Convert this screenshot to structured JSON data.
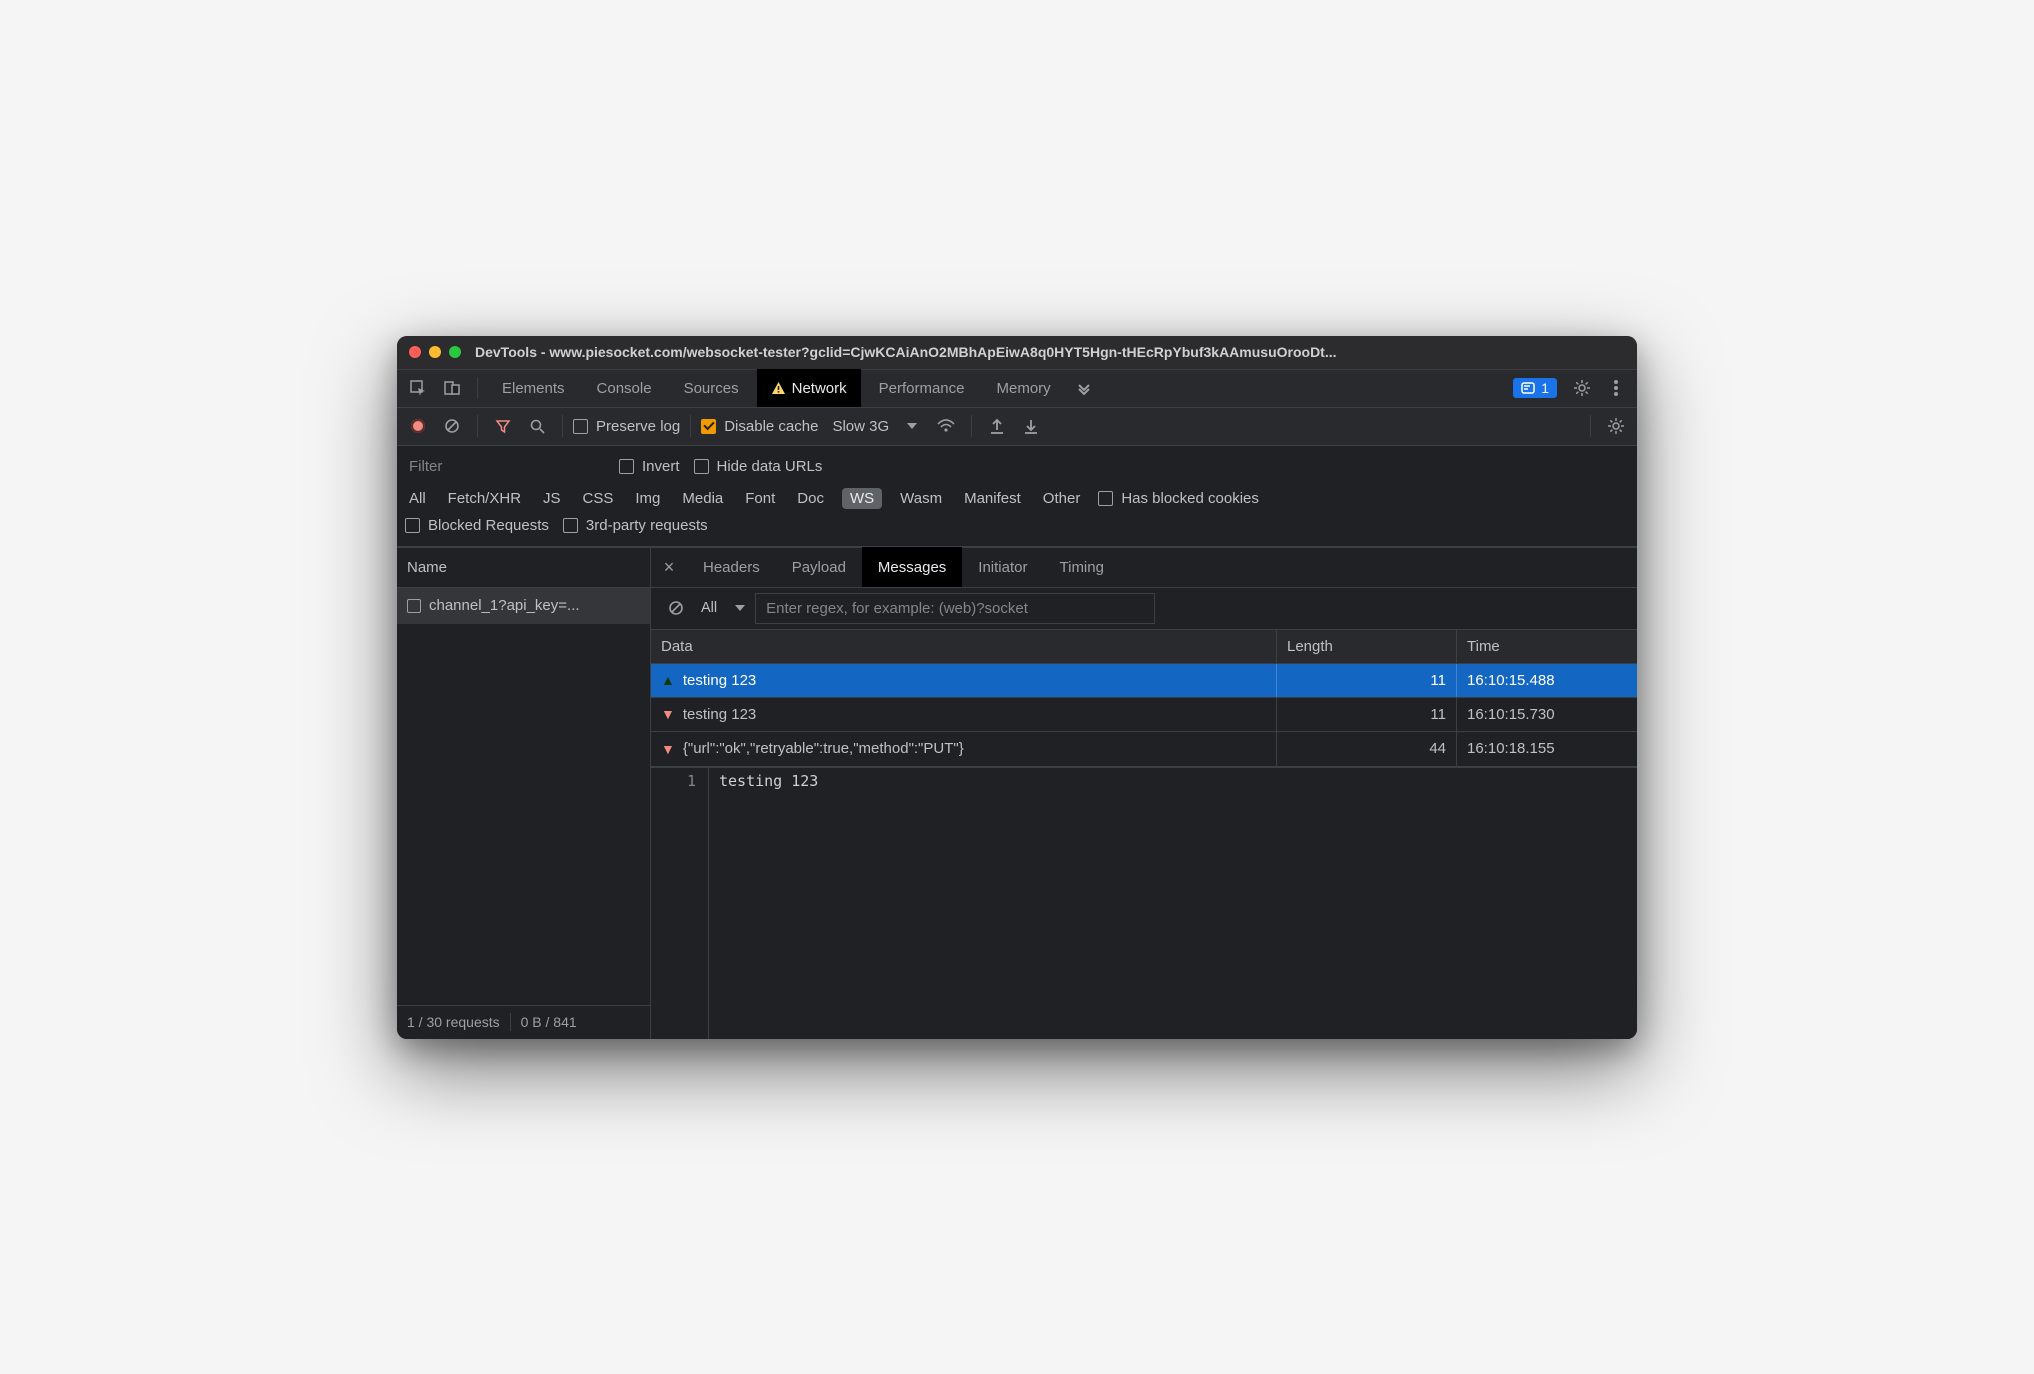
{
  "window": {
    "title": "DevTools - www.piesocket.com/websocket-tester?gclid=CjwKCAiAnO2MBhApEiwA8q0HYT5Hgn-tHEcRpYbuf3kAAmusuOrooDt..."
  },
  "main_tabs": [
    "Elements",
    "Console",
    "Sources",
    "Network",
    "Performance",
    "Memory"
  ],
  "main_tab_active": "Network",
  "issues_badge": "1",
  "toolbar": {
    "preserve_log_label": "Preserve log",
    "disable_cache_label": "Disable cache",
    "disable_cache_checked": true,
    "throttling": "Slow 3G"
  },
  "filter": {
    "placeholder": "Filter",
    "invert_label": "Invert",
    "hide_data_urls_label": "Hide data URLs",
    "types": [
      "All",
      "Fetch/XHR",
      "JS",
      "CSS",
      "Img",
      "Media",
      "Font",
      "Doc",
      "WS",
      "Wasm",
      "Manifest",
      "Other"
    ],
    "type_selected": "WS",
    "has_blocked_cookies_label": "Has blocked cookies",
    "blocked_requests_label": "Blocked Requests",
    "third_party_label": "3rd-party requests"
  },
  "sidebar": {
    "header": "Name",
    "requests": [
      {
        "label": "channel_1?api_key=..."
      }
    ],
    "status_requests": "1 / 30 requests",
    "status_bytes": "0 B / 841"
  },
  "detail_tabs": [
    "Headers",
    "Payload",
    "Messages",
    "Initiator",
    "Timing"
  ],
  "detail_tab_active": "Messages",
  "messages": {
    "filter_mode": "All",
    "regex_placeholder": "Enter regex, for example: (web)?socket",
    "columns": {
      "data": "Data",
      "length": "Length",
      "time": "Time"
    },
    "rows": [
      {
        "dir": "up",
        "data": "testing 123",
        "length": "11",
        "time": "16:10:15.488",
        "selected": true
      },
      {
        "dir": "down",
        "data": "testing 123",
        "length": "11",
        "time": "16:10:15.730"
      },
      {
        "dir": "down",
        "data": "{\"url\":\"ok\",\"retryable\":true,\"method\":\"PUT\"}",
        "length": "44",
        "time": "16:10:18.155"
      }
    ],
    "preview_line_no": "1",
    "preview_text": "testing 123"
  }
}
